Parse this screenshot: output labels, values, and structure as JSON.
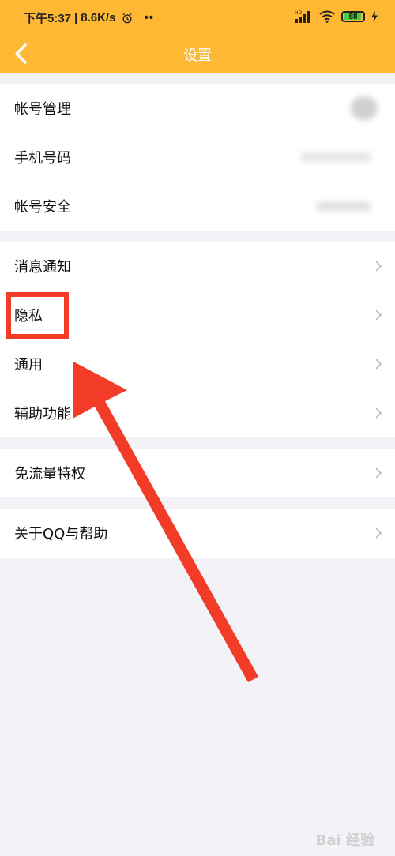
{
  "status_bar": {
    "time": "下午5:37",
    "separator": "|",
    "network_speed": "8.6K/s",
    "dots": "••",
    "hd_badge": "HD",
    "battery_level": "88",
    "icons": [
      "alarm-icon",
      "signal-icon",
      "wifi-icon",
      "battery-icon",
      "charging-icon"
    ]
  },
  "nav": {
    "title": "设置",
    "back_icon": "chevron-left-icon"
  },
  "groups": [
    {
      "items": [
        {
          "label": "帐号管理"
        },
        {
          "label": "手机号码"
        },
        {
          "label": "帐号安全"
        }
      ]
    },
    {
      "items": [
        {
          "label": "消息通知"
        },
        {
          "label": "隐私"
        },
        {
          "label": "通用"
        },
        {
          "label": "辅助功能"
        }
      ]
    },
    {
      "items": [
        {
          "label": "免流量特权"
        }
      ]
    },
    {
      "items": [
        {
          "label": "关于QQ与帮助"
        }
      ]
    }
  ],
  "annotation": {
    "highlight_color": "#f23c28",
    "target": "隐私"
  },
  "watermark": "Bai 经验",
  "colors": {
    "header": "#ffb834",
    "background": "#f2f2f7",
    "battery_fill": "#4fce3a"
  }
}
